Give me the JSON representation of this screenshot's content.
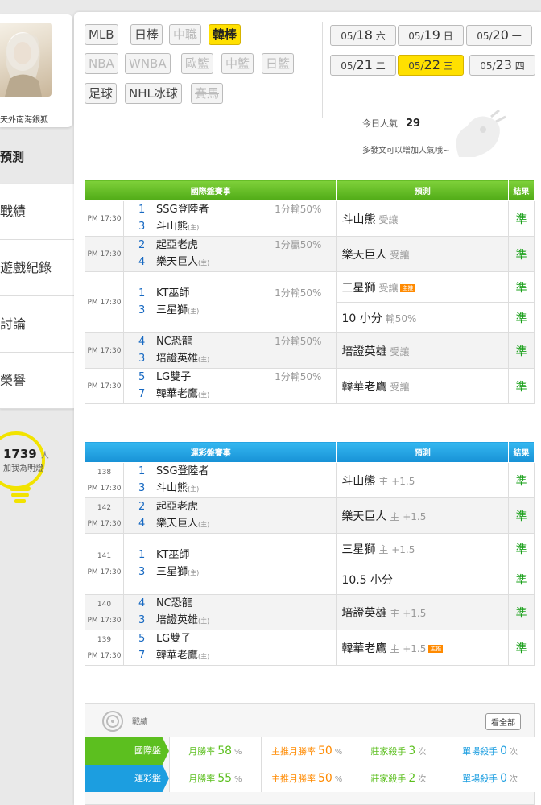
{
  "user": {
    "name": "天外南海銀狐"
  },
  "sidebar": {
    "section_title": "預測",
    "menu": [
      "戰績",
      "遊戲紀錄",
      "討論",
      "榮譽"
    ],
    "popularity_count": "1739",
    "popularity_unit": "人",
    "popularity_text": "加我為明燈"
  },
  "sports": {
    "rows": [
      [
        {
          "label": "MLB",
          "state": "normal"
        },
        {
          "label": "日棒",
          "state": "normal"
        },
        {
          "label": "中職",
          "state": "disabled"
        },
        {
          "label": "韓棒",
          "state": "active"
        }
      ],
      [
        {
          "label": "NBA",
          "state": "disabled"
        },
        {
          "label": "WNBA",
          "state": "disabled"
        },
        {
          "label": "歐籃",
          "state": "disabled"
        },
        {
          "label": "中籃",
          "state": "disabled"
        },
        {
          "label": "日籃",
          "state": "disabled"
        }
      ],
      [
        {
          "label": "足球",
          "state": "normal"
        },
        {
          "label": "NHL冰球",
          "state": "normal"
        },
        {
          "label": "賽馬",
          "state": "disabled"
        }
      ]
    ]
  },
  "dates": [
    {
      "md": "05/",
      "day": "18",
      "wd": "六",
      "active": false
    },
    {
      "md": "05/",
      "day": "19",
      "wd": "日",
      "active": false
    },
    {
      "md": "05/",
      "day": "20",
      "wd": "一",
      "active": false
    },
    {
      "md": "05/",
      "day": "21",
      "wd": "二",
      "active": false
    },
    {
      "md": "05/",
      "day": "22",
      "wd": "三",
      "active": true
    },
    {
      "md": "05/",
      "day": "23",
      "wd": "四",
      "active": false
    }
  ],
  "today": {
    "label": "今日人氣",
    "count": "29",
    "hint": "多發文可以增加人氣哦~"
  },
  "international": {
    "headers": [
      "國際盤賽事",
      "預測",
      "結果"
    ],
    "games": [
      {
        "time": "PM 17:30",
        "num1": "1",
        "team1": "SSG登陸者",
        "num2": "3",
        "team2": "斗山熊",
        "home": "(主)",
        "odds": "1分輸50%",
        "preds": [
          {
            "text": "斗山熊",
            "sub": "受讓",
            "icon": "",
            "result": "準"
          }
        ]
      },
      {
        "time": "PM 17:30",
        "num1": "2",
        "team1": "起亞老虎",
        "num2": "4",
        "team2": "樂天巨人",
        "home": "(主)",
        "odds": "1分贏50%",
        "preds": [
          {
            "text": "樂天巨人",
            "sub": "受讓",
            "icon": "",
            "result": "準"
          }
        ]
      },
      {
        "time": "PM 17:30",
        "num1": "1",
        "team1": "KT巫師",
        "num2": "3",
        "team2": "三星獅",
        "home": "(主)",
        "odds": "1分輸50%",
        "preds": [
          {
            "text": "三星獅",
            "sub": "受讓",
            "icon": "主推",
            "result": "準"
          },
          {
            "text": "10 小分",
            "sub": "輸50%",
            "icon": "",
            "result": "準"
          }
        ]
      },
      {
        "time": "PM 17:30",
        "num1": "4",
        "team1": "NC恐龍",
        "num2": "3",
        "team2": "培證英雄",
        "home": "(主)",
        "odds": "1分輸50%",
        "preds": [
          {
            "text": "培證英雄",
            "sub": "受讓",
            "icon": "",
            "result": "準"
          }
        ]
      },
      {
        "time": "PM 17:30",
        "num1": "5",
        "team1": "LG雙子",
        "num2": "7",
        "team2": "韓華老鷹",
        "home": "(主)",
        "odds": "1分輸50%",
        "preds": [
          {
            "text": "韓華老鷹",
            "sub": "受讓",
            "icon": "",
            "result": "準"
          }
        ]
      }
    ]
  },
  "lottery": {
    "headers": [
      "運彩盤賽事",
      "預測",
      "結果"
    ],
    "games": [
      {
        "id": "138",
        "time": "PM 17:30",
        "num1": "1",
        "team1": "SSG登陸者",
        "num2": "3",
        "team2": "斗山熊",
        "home": "(主)",
        "preds": [
          {
            "text": "斗山熊",
            "sub": "主 +1.5",
            "icon": "",
            "result": "準"
          }
        ]
      },
      {
        "id": "142",
        "time": "PM 17:30",
        "num1": "2",
        "team1": "起亞老虎",
        "num2": "4",
        "team2": "樂天巨人",
        "home": "(主)",
        "preds": [
          {
            "text": "樂天巨人",
            "sub": "主 +1.5",
            "icon": "",
            "result": "準"
          }
        ]
      },
      {
        "id": "141",
        "time": "PM 17:30",
        "num1": "1",
        "team1": "KT巫師",
        "num2": "3",
        "team2": "三星獅",
        "home": "(主)",
        "preds": [
          {
            "text": "三星獅",
            "sub": "主 +1.5",
            "icon": "",
            "result": "準"
          },
          {
            "text": "10.5 小分",
            "sub": "",
            "icon": "",
            "result": "準"
          }
        ]
      },
      {
        "id": "140",
        "time": "PM 17:30",
        "num1": "4",
        "team1": "NC恐龍",
        "num2": "3",
        "team2": "培證英雄",
        "home": "(主)",
        "preds": [
          {
            "text": "培證英雄",
            "sub": "主 +1.5",
            "icon": "",
            "result": "準"
          }
        ]
      },
      {
        "id": "139",
        "time": "PM 17:30",
        "num1": "5",
        "team1": "LG雙子",
        "num2": "7",
        "team2": "韓華老鷹",
        "home": "(主)",
        "preds": [
          {
            "text": "韓華老鷹",
            "sub": "主 +1.5",
            "icon": "主推",
            "result": "準"
          }
        ]
      }
    ]
  },
  "stats": {
    "title": "戰績",
    "view_all": "看全部",
    "rows": [
      {
        "label": "國際盤",
        "color": "#5cbf1f",
        "month_label": "月勝率",
        "month_value": "58",
        "month_unit": "%",
        "main_label": "主推月勝率",
        "main_value": "50",
        "main_unit": "%",
        "bank_label": "莊家殺手",
        "bank_value": "3",
        "bank_unit": "次",
        "single_label": "單場殺手",
        "single_value": "0",
        "single_unit": "次"
      },
      {
        "label": "運彩盤",
        "color": "#1c9ee0",
        "month_label": "月勝率",
        "month_value": "55",
        "month_unit": "%",
        "main_label": "主推月勝率",
        "main_value": "50",
        "main_unit": "%",
        "bank_label": "莊家殺手",
        "bank_value": "2",
        "bank_unit": "次",
        "single_label": "單場殺手",
        "single_value": "0",
        "single_unit": "次"
      }
    ]
  },
  "colors": {
    "green": "#5cbf1f",
    "blue": "#1c9ee0",
    "yellow": "#ffe000",
    "result_green": "#1aa01a",
    "orange": "#ff8a00",
    "team_num": "#1769c2"
  }
}
